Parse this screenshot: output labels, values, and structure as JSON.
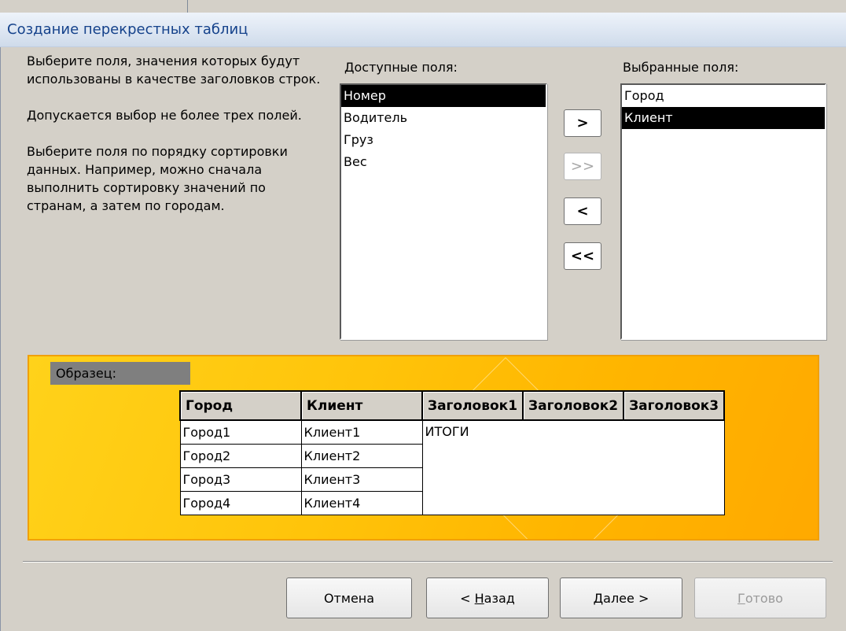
{
  "window": {
    "title": "Создание перекрестных таблиц"
  },
  "instructions": {
    "p1": "Выберите поля, значения которых будут использованы в качестве заголовков строк.",
    "p2": "Допускается выбор не более трех полей.",
    "p3": "Выберите поля по порядку сортировки данных.  Например, можно сначала выполнить сортировку значений по странам, а затем по городам."
  },
  "available": {
    "label": "Доступные поля:",
    "items": [
      "Номер",
      "Водитель",
      "Груз",
      "Вес"
    ],
    "selected_index": 0
  },
  "selected": {
    "label": "Выбранные поля:",
    "items": [
      "Город",
      "Клиент"
    ],
    "selected_index": 1
  },
  "move_buttons": [
    {
      "name": "move-one-right-button",
      "label": ">",
      "enabled": true
    },
    {
      "name": "move-all-right-button",
      "label": ">>",
      "enabled": false
    },
    {
      "name": "move-one-left-button",
      "label": "<",
      "enabled": true
    },
    {
      "name": "move-all-left-button",
      "label": "<<",
      "enabled": true
    }
  ],
  "sample": {
    "label": "Образец:",
    "headers": [
      "Город",
      "Клиент",
      "Заголовок1",
      "Заголовок2",
      "Заголовок3"
    ],
    "rows": [
      [
        "Город1",
        "Клиент1"
      ],
      [
        "Город2",
        "Клиент2"
      ],
      [
        "Город3",
        "Клиент3"
      ],
      [
        "Город4",
        "Клиент4"
      ]
    ],
    "totals": "ИТОГИ"
  },
  "footer": {
    "cancel": {
      "text": "Отмена",
      "enabled": true
    },
    "back": {
      "prefix": "< ",
      "mnemonic": "Н",
      "rest": "азад",
      "enabled": true
    },
    "next": {
      "prefix": "",
      "mnemonic": "Д",
      "rest": "алее >",
      "enabled": true
    },
    "finish": {
      "prefix": "",
      "mnemonic": "Г",
      "rest": "отово",
      "enabled": false
    }
  }
}
